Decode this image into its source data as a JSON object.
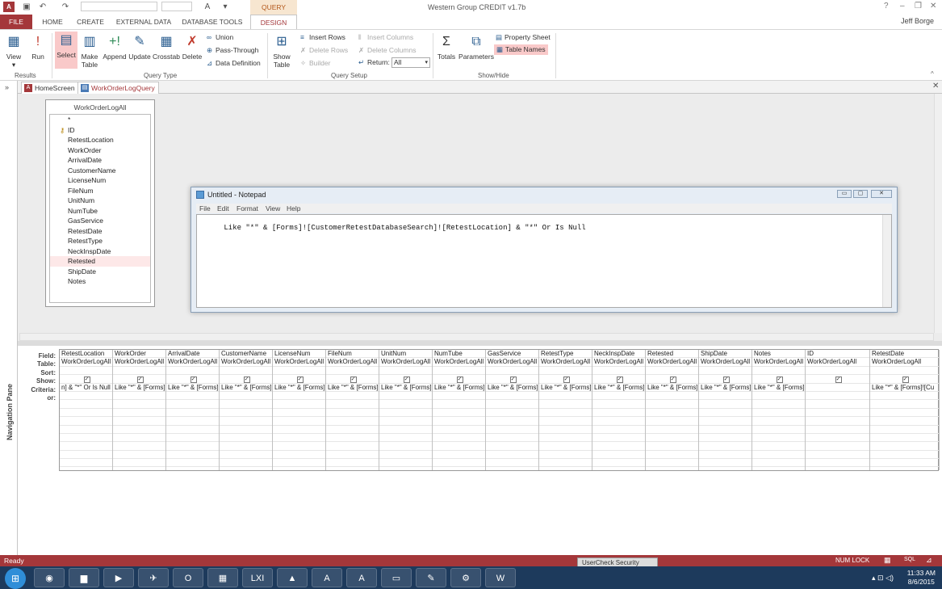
{
  "window": {
    "title": "Western Group CREDIT v1.7b",
    "context_tab": "QUERY TOOLS",
    "user": "Jeff Borge",
    "help": "?"
  },
  "tabs": [
    "FILE",
    "HOME",
    "CREATE",
    "EXTERNAL DATA",
    "DATABASE TOOLS",
    "DESIGN"
  ],
  "ribbon": {
    "results": {
      "label": "Results",
      "view": "View",
      "run": "Run"
    },
    "query_type": {
      "label": "Query Type",
      "select": "Select",
      "make_table": "Make Table",
      "append": "Append",
      "update": "Update",
      "crosstab": "Crosstab",
      "delete": "Delete",
      "union": "Union",
      "pass_through": "Pass-Through",
      "data_definition": "Data Definition"
    },
    "query_setup": {
      "label": "Query Setup",
      "show_table": "Show Table",
      "insert_rows": "Insert Rows",
      "delete_rows": "Delete Rows",
      "builder": "Builder",
      "insert_columns": "Insert Columns",
      "delete_columns": "Delete Columns",
      "return_label": "Return:",
      "return_value": "All"
    },
    "show_hide": {
      "label": "Show/Hide",
      "totals": "Totals",
      "parameters": "Parameters",
      "property_sheet": "Property Sheet",
      "table_names": "Table Names"
    }
  },
  "doc_tabs": [
    "HomeScreen",
    "WorkOrderLogQuery"
  ],
  "nav_pane": "Navigation Pane",
  "table": {
    "name": "WorkOrderLogAll",
    "fields": [
      "*",
      "ID",
      "RetestLocation",
      "WorkOrder",
      "ArrivalDate",
      "CustomerName",
      "LicenseNum",
      "FileNum",
      "UnitNum",
      "NumTube",
      "GasService",
      "RetestDate",
      "RetestType",
      "NeckInspDate",
      "Retested",
      "ShipDate",
      "Notes"
    ]
  },
  "notepad": {
    "title": "Untitled - Notepad",
    "menu": [
      "File",
      "Edit",
      "Format",
      "View",
      "Help"
    ],
    "text": "Like \"*\" & [Forms]![CustomerRetestDatabaseSearch]![RetestLocation] & \"*\" Or Is Null"
  },
  "grid": {
    "row_labels": [
      "Field:",
      "Table:",
      "Sort:",
      "Show:",
      "Criteria:",
      "or:"
    ],
    "columns": [
      {
        "field": "RetestLocation",
        "table": "WorkOrderLogAll",
        "criteria": "n] & \"*\" Or Is Null"
      },
      {
        "field": "WorkOrder",
        "table": "WorkOrderLogAll",
        "criteria": "Like \"*\" & [Forms]!"
      },
      {
        "field": "ArrivalDate",
        "table": "WorkOrderLogAll",
        "criteria": "Like \"*\" & [Forms]!"
      },
      {
        "field": "CustomerName",
        "table": "WorkOrderLogAll",
        "criteria": "Like \"*\" & [Forms]!"
      },
      {
        "field": "LicenseNum",
        "table": "WorkOrderLogAll",
        "criteria": "Like \"*\" & [Forms]!"
      },
      {
        "field": "FileNum",
        "table": "WorkOrderLogAll",
        "criteria": "Like \"*\" & [Forms]!"
      },
      {
        "field": "UnitNum",
        "table": "WorkOrderLogAll",
        "criteria": "Like \"*\" & [Forms]!"
      },
      {
        "field": "NumTube",
        "table": "WorkOrderLogAll",
        "criteria": "Like \"*\" & [Forms]!"
      },
      {
        "field": "GasService",
        "table": "WorkOrderLogAll",
        "criteria": "Like \"*\" & [Forms]!"
      },
      {
        "field": "RetestType",
        "table": "WorkOrderLogAll",
        "criteria": "Like \"*\" & [Forms]!"
      },
      {
        "field": "NeckInspDate",
        "table": "WorkOrderLogAll",
        "criteria": "Like \"*\" & [Forms]"
      },
      {
        "field": "Retested",
        "table": "WorkOrderLogAll",
        "criteria": "Like \"*\" & [Forms]!"
      },
      {
        "field": "ShipDate",
        "table": "WorkOrderLogAll",
        "criteria": "Like \"*\" & [Forms]!"
      },
      {
        "field": "Notes",
        "table": "WorkOrderLogAll",
        "criteria": "Like \"*\" & [Forms]!"
      },
      {
        "field": "ID",
        "table": "WorkOrderLogAll",
        "criteria": ""
      },
      {
        "field": "RetestDate",
        "table": "WorkOrderLogAll",
        "criteria": "Like \"*\" & [Forms]![Cu"
      }
    ]
  },
  "status": {
    "text": "Ready",
    "num_lock": "NUM LOCK",
    "popup": "UserCheck Security"
  },
  "taskbar": {
    "time": "11:33 AM",
    "date": "8/6/2015",
    "apps": [
      "chrome",
      "explorer",
      "media",
      "outlook-bird",
      "outlook",
      "calculator",
      "lxi",
      "acrobat",
      "access",
      "access2",
      "explorer2",
      "notes",
      "settings",
      "word"
    ]
  },
  "colors": {
    "accent": "#a4373a",
    "taskbar": "#1d3a5c"
  }
}
